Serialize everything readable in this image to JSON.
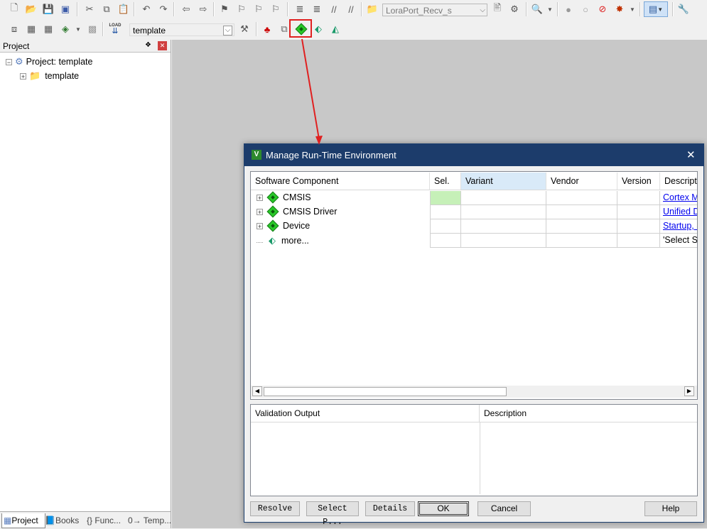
{
  "toolbar1": {
    "target_combo": "LoraPort_Recv_s"
  },
  "toolbar2": {
    "load_label": "LOAD",
    "target_select": "template"
  },
  "project_pane": {
    "title": "Project",
    "pin": "❖",
    "close": "✕",
    "tree": {
      "root_label": "Project: template",
      "child_label": "template"
    },
    "tabs": [
      {
        "label": "Project"
      },
      {
        "label": "Books"
      },
      {
        "label": "{} Func..."
      },
      {
        "label": "0→ Temp..."
      }
    ]
  },
  "dialog": {
    "title": "Manage Run-Time Environment",
    "close": "✕",
    "columns": {
      "component": "Software Component",
      "sel": "Sel.",
      "variant": "Variant",
      "vendor": "Vendor",
      "version": "Version",
      "description": "Descripti"
    },
    "rows": [
      {
        "name": "CMSIS",
        "description": "Cortex M"
      },
      {
        "name": "CMSIS Driver",
        "description": "Unified D"
      },
      {
        "name": "Device",
        "description": "Startup, S"
      },
      {
        "name": "more...",
        "description": "'Select Sc"
      }
    ],
    "validation": {
      "output_header": "Validation Output",
      "description_header": "Description"
    },
    "buttons": {
      "resolve": "Resolve",
      "select_packs": "Select P...",
      "details": "Details",
      "ok": "OK",
      "cancel": "Cancel",
      "help": "Help"
    }
  },
  "annotation": {
    "highlight_color": "#e02020"
  }
}
